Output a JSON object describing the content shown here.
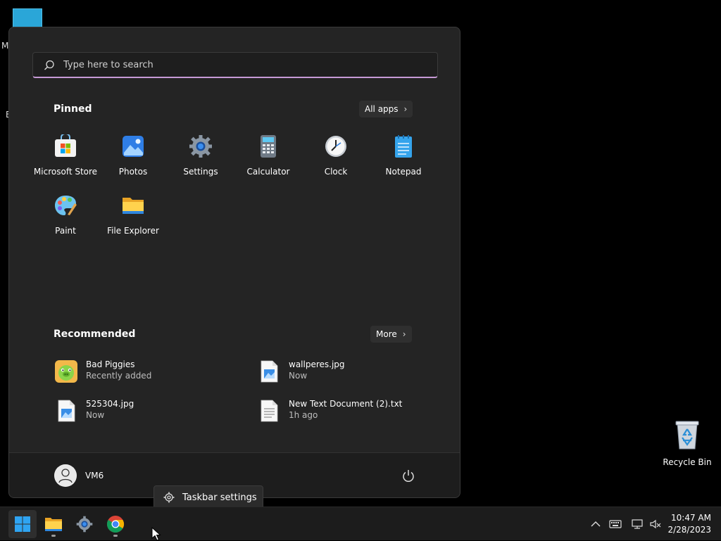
{
  "desktop": {
    "frag_m": "M",
    "frag_e": "E",
    "recycle_bin_label": "Recycle Bin"
  },
  "start_menu": {
    "search_placeholder": "Type here to search",
    "pinned_title": "Pinned",
    "all_apps_label": "All apps",
    "pinned_apps": [
      {
        "label": "Microsoft Store",
        "icon": "microsoft-store-icon"
      },
      {
        "label": "Photos",
        "icon": "photos-icon"
      },
      {
        "label": "Settings",
        "icon": "settings-icon"
      },
      {
        "label": "Calculator",
        "icon": "calculator-icon"
      },
      {
        "label": "Clock",
        "icon": "clock-icon"
      },
      {
        "label": "Notepad",
        "icon": "notepad-icon"
      },
      {
        "label": "Paint",
        "icon": "paint-icon"
      },
      {
        "label": "File Explorer",
        "icon": "file-explorer-icon"
      }
    ],
    "recommended_title": "Recommended",
    "more_label": "More",
    "recommended": [
      {
        "name": "Bad Piggies",
        "sub": "Recently added",
        "icon": "bad-piggies-icon"
      },
      {
        "name": "wallperes.jpg",
        "sub": "Now",
        "icon": "image-file-icon"
      },
      {
        "name": "525304.jpg",
        "sub": "Now",
        "icon": "image-file-icon"
      },
      {
        "name": "New Text Document (2).txt",
        "sub": "1h ago",
        "icon": "text-file-icon"
      }
    ],
    "user_name": "VM6"
  },
  "context_popup": {
    "label": "Taskbar settings"
  },
  "taskbar": {
    "apps": [
      "start-button",
      "file-explorer",
      "settings",
      "chrome"
    ],
    "time": "10:47 AM",
    "date": "2/28/2023"
  },
  "colors": {
    "accent_search_underline": "#c79ad6",
    "start_bg": "#242424",
    "taskbar_bg": "#1c1c1c"
  }
}
